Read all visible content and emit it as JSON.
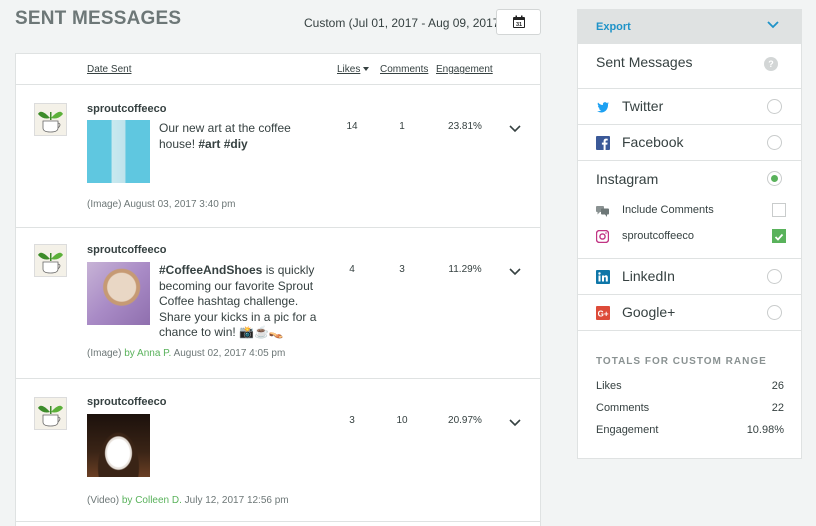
{
  "header": {
    "title": "SENT MESSAGES",
    "date_range": "Custom (Jul 01, 2017 - Aug 09, 2017)",
    "calendar_day": "31"
  },
  "table": {
    "columns": {
      "date_sent": "Date Sent",
      "likes": "Likes",
      "comments": "Comments",
      "engagement": "Engagement"
    },
    "rows": [
      {
        "handle": "sproutcoffeeco",
        "text_plain": "Our new art at the coffee house! ",
        "text_bold": "#art #diy",
        "likes": "14",
        "comments": "1",
        "engagement": "23.81%",
        "media_type": "(Image)",
        "by": "",
        "author": "",
        "date": "August 03, 2017 3:40 pm"
      },
      {
        "handle": "sproutcoffeeco",
        "text_bold": "#CoffeeAndShoes",
        "text_plain": " is quickly becoming our favorite Sprout Coffee hashtag challenge. Share your kicks in a pic for a chance to win! 📸☕👡",
        "likes": "4",
        "comments": "3",
        "engagement": "11.29%",
        "media_type": "(Image)",
        "by": "by",
        "author": "Anna P.",
        "date": "August 02, 2017 4:05 pm"
      },
      {
        "handle": "sproutcoffeeco",
        "text_plain": "",
        "text_bold": "",
        "likes": "3",
        "comments": "10",
        "engagement": "20.97%",
        "media_type": "(Video)",
        "by": "by",
        "author": "Colleen D.",
        "date": "July 12, 2017 12:56 pm"
      }
    ]
  },
  "panel": {
    "export_label": "Export",
    "section_title": "Sent Messages",
    "help": "?",
    "networks": {
      "twitter": "Twitter",
      "facebook": "Facebook",
      "instagram": "Instagram",
      "linkedin": "LinkedIn",
      "googleplus": "Google+"
    },
    "selected_network": "instagram",
    "include_comments": "Include Comments",
    "account": "sproutcoffeeco",
    "account_checked": true,
    "include_comments_checked": false,
    "totals_title": "TOTALS FOR CUSTOM RANGE",
    "totals": {
      "likes_label": "Likes",
      "likes": "26",
      "comments_label": "Comments",
      "comments": "22",
      "engagement_label": "Engagement",
      "engagement": "10.98%"
    }
  },
  "colors": {
    "accent_blue": "#1f93c8",
    "green": "#59b25b",
    "twitter": "#1da1f2",
    "facebook": "#3b5998",
    "linkedin": "#0e76a8",
    "googleplus": "#dd4b39",
    "instagram": "#c13584"
  },
  "icons": [
    "calendar-icon",
    "chevron-down-icon",
    "twitter-icon",
    "facebook-icon",
    "linkedin-icon",
    "googleplus-icon",
    "instagram-icon",
    "comments-icon",
    "help-icon"
  ]
}
